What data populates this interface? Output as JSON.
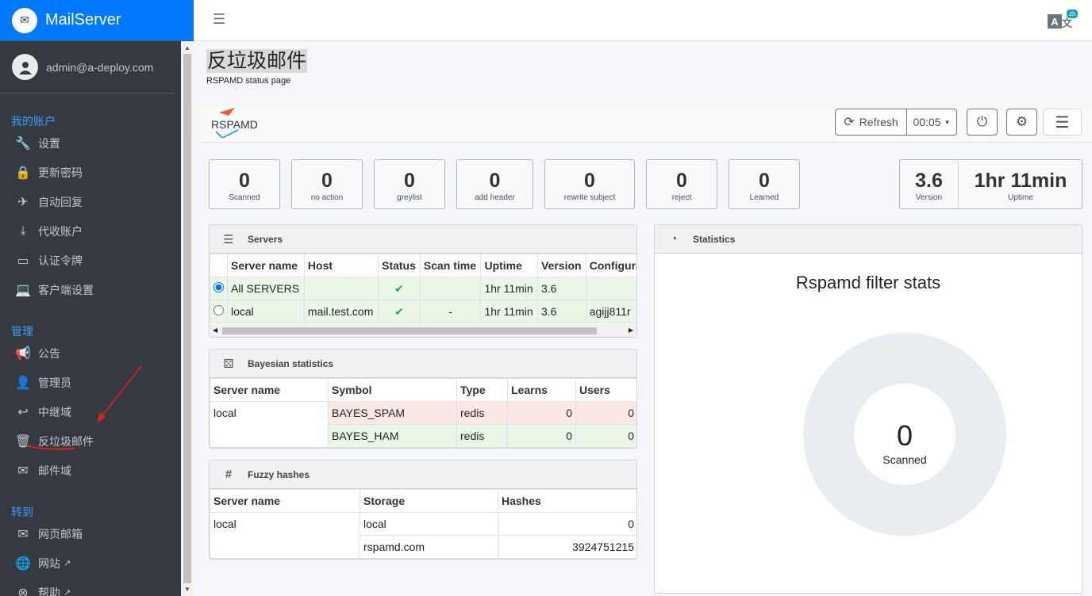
{
  "app": {
    "name": "MailServer",
    "user": "admin@a-deploy.com"
  },
  "sidebar": {
    "sections": [
      {
        "title": "我的账户",
        "items": [
          {
            "label": "设置",
            "icon": "wrench-icon"
          },
          {
            "label": "更新密码",
            "icon": "lock-icon"
          },
          {
            "label": "自动回复",
            "icon": "plane-icon"
          },
          {
            "label": "代收账户",
            "icon": "download-icon"
          },
          {
            "label": "认证令牌",
            "icon": "token-icon"
          },
          {
            "label": "客户端设置",
            "icon": "laptop-icon"
          }
        ]
      },
      {
        "title": "管理",
        "items": [
          {
            "label": "公告",
            "icon": "bullhorn-icon"
          },
          {
            "label": "管理员",
            "icon": "user-icon"
          },
          {
            "label": "中继域",
            "icon": "reply-icon"
          },
          {
            "label": "反垃圾邮件",
            "icon": "trash-icon"
          },
          {
            "label": "邮件域",
            "icon": "envelope-icon"
          }
        ]
      },
      {
        "title": "转到",
        "items": [
          {
            "label": "网页邮箱",
            "icon": "envelope-open-icon"
          },
          {
            "label": "网站",
            "icon": "globe-icon"
          },
          {
            "label": "帮助",
            "icon": "lifebuoy-icon"
          }
        ]
      }
    ]
  },
  "topbar": {
    "lang_badge": "zh"
  },
  "page": {
    "title": "反垃圾邮件",
    "subtitle": "RSPAMD status page"
  },
  "rspamd": {
    "logo": "RSPAMD",
    "refresh": "Refresh",
    "interval": "00:05"
  },
  "tiles": [
    {
      "value": "0",
      "label": "Scanned"
    },
    {
      "value": "0",
      "label": "no action"
    },
    {
      "value": "0",
      "label": "greylist"
    },
    {
      "value": "0",
      "label": "add header"
    },
    {
      "value": "0",
      "label": "rewrite subject"
    },
    {
      "value": "0",
      "label": "reject"
    },
    {
      "value": "0",
      "label": "Learned"
    }
  ],
  "version": {
    "version": "3.6",
    "version_label": "Version",
    "uptime": "1hr 11min",
    "uptime_label": "Uptime"
  },
  "servers": {
    "title": "Servers",
    "headers": [
      "Server name",
      "Host",
      "Status",
      "Scan time",
      "Uptime",
      "Version",
      "Configurati"
    ],
    "rows": [
      [
        "All SERVERS",
        "",
        "✔",
        "",
        "1hr 11min",
        "3.6",
        ""
      ],
      [
        "local",
        "mail.test.com",
        "✔",
        "-",
        "1hr 11min",
        "3.6",
        "agijj811r"
      ]
    ]
  },
  "bayes": {
    "title": "Bayesian statistics",
    "headers": [
      "Server name",
      "Symbol",
      "Type",
      "Learns",
      "Users"
    ],
    "rows": [
      [
        "local",
        "BAYES_SPAM",
        "redis",
        "0",
        "0"
      ],
      [
        "",
        "BAYES_HAM",
        "redis",
        "0",
        "0"
      ]
    ]
  },
  "fuzzy": {
    "title": "Fuzzy hashes",
    "headers": [
      "Server name",
      "Storage",
      "Hashes"
    ],
    "rows": [
      [
        "local",
        "local",
        "0"
      ],
      [
        "",
        "rspamd.com",
        "3924751215"
      ]
    ]
  },
  "statistics": {
    "title": "Statistics",
    "chart_title": "Rspamd filter stats",
    "center_value": "0",
    "center_label": "Scanned"
  }
}
